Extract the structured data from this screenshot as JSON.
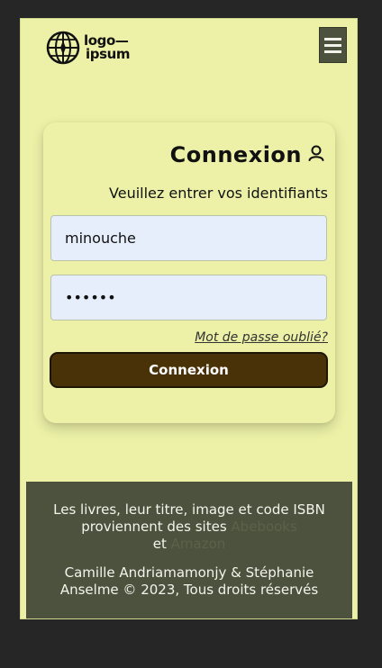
{
  "header": {
    "logo": {
      "line1": "logo—",
      "line2": "ipsum",
      "icon": "globe-icon"
    },
    "menu_icon": "hamburger-icon"
  },
  "login": {
    "title": "Connexion",
    "title_icon": "user-icon",
    "subtitle": "Veuillez entrer vos identifiants",
    "username_value": "minouche",
    "password_value": "••••••",
    "forgot_link": "Mot de passe oublié?",
    "submit_label": "Connexion"
  },
  "footer": {
    "sources_prefix": "Les livres, leur titre, image et code ISBN proviennent des sites ",
    "source1": "Abebooks",
    "conjunction": " et ",
    "source2": "Amazon",
    "copyright": "Camille Andriamamonjy & Stéphanie Anselme © 2023, Tous droits réservés"
  },
  "colors": {
    "page_bg": "#ecf1a7",
    "outer_bg": "#262626",
    "footer_bg": "#4d523e",
    "button_bg": "#4a3208",
    "input_bg": "#e6eefb"
  }
}
